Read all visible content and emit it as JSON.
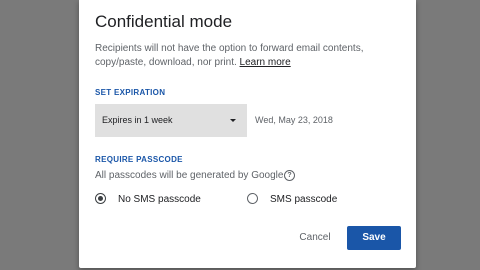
{
  "dialog": {
    "title": "Confidential mode",
    "description": "Recipients will not have the option to forward email contents, copy/paste, download, nor print.",
    "learn_more": "Learn more"
  },
  "expiration": {
    "section_label": "SET EXPIRATION",
    "selected": "Expires in 1 week",
    "date": "Wed, May 23, 2018"
  },
  "passcode": {
    "section_label": "REQUIRE PASSCODE",
    "note": "All passcodes will be generated by Google.",
    "options": [
      {
        "label": "No SMS passcode",
        "checked": true
      },
      {
        "label": "SMS passcode",
        "checked": false
      }
    ]
  },
  "actions": {
    "cancel": "Cancel",
    "save": "Save"
  },
  "colors": {
    "accent": "#1a56a8",
    "overlay": "#7a7a7a"
  },
  "icons": [
    "help-icon",
    "chevron-down-icon"
  ]
}
